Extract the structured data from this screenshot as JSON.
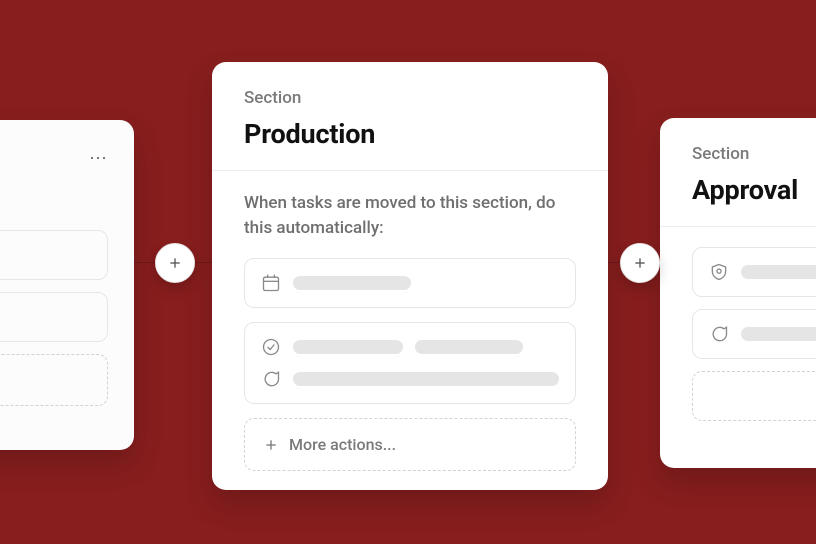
{
  "connector": {
    "exists": true
  },
  "left_card": {
    "menu_glyph": "⋯"
  },
  "center_card": {
    "eyebrow": "Section",
    "title": "Production",
    "rule_text": "When tasks are moved to this section, do this automatically:",
    "rules": [
      {
        "icons": [
          "calendar"
        ],
        "bars": [
          118
        ]
      },
      {
        "icons": [
          "status",
          "comment"
        ],
        "bars_row1": [
          110,
          108
        ],
        "bars_row2": [
          272
        ]
      }
    ],
    "more_actions": "More actions..."
  },
  "right_card": {
    "eyebrow": "Section",
    "title": "Approval",
    "rules": [
      {
        "icons": [
          "shield"
        ],
        "bars": [
          110
        ]
      },
      {
        "icons": [
          "comment"
        ],
        "bars": [
          110
        ]
      }
    ]
  }
}
